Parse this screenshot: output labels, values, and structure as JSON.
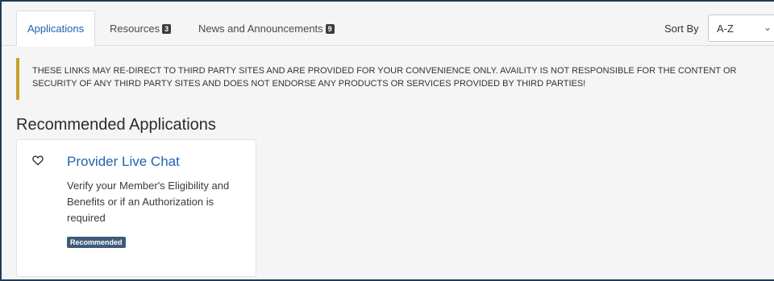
{
  "tabs": [
    {
      "label": "Applications",
      "active": true
    },
    {
      "label": "Resources",
      "badge": "3"
    },
    {
      "label": "News and Announcements",
      "badge": "9"
    }
  ],
  "sort": {
    "label": "Sort By",
    "value": "A-Z"
  },
  "warning": "THESE LINKS MAY RE-DIRECT TO THIRD PARTY SITES AND ARE PROVIDED FOR YOUR CONVENIENCE ONLY. AVAILITY IS NOT RESPONSIBLE FOR THE CONTENT OR SECURITY OF ANY THIRD PARTY SITES AND DOES NOT ENDORSE ANY PRODUCTS OR SERVICES PROVIDED BY THIRD PARTIES!",
  "section_title": "Recommended Applications",
  "cards": [
    {
      "title": "Provider Live Chat",
      "description": "Verify your Member's Eligibility and Benefits or if an Authorization is required",
      "badge": "Recommended",
      "icon": "heart-outline-icon"
    }
  ],
  "colors": {
    "accent": "#2261b0",
    "warning_border": "#c8a12c",
    "badge_dark": "#3d3d3d",
    "recommended_badge": "#3e5c7a",
    "frame_border": "#1f3b57"
  }
}
